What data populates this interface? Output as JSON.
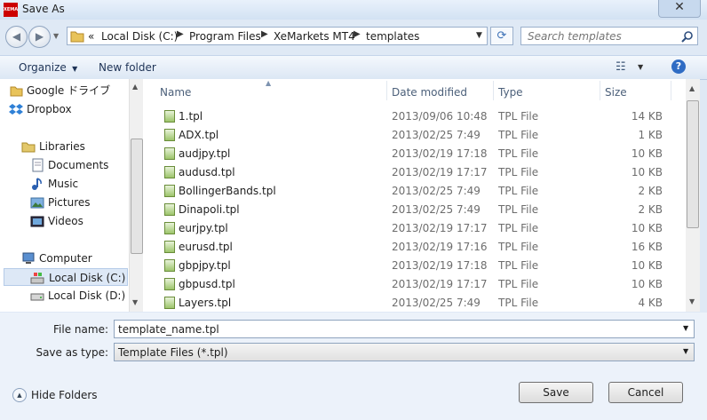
{
  "window": {
    "title": "Save As",
    "app_icon_text": "XEMA",
    "close_glyph": "✕"
  },
  "address": {
    "overflow_glyph": "«",
    "crumbs": [
      "Local Disk (C:)",
      "Program Files",
      "XeMarkets MT4",
      "templates"
    ]
  },
  "search": {
    "placeholder": "Search templates"
  },
  "toolbar": {
    "organize": "Organize",
    "new_folder": "New folder"
  },
  "nav": {
    "items": [
      "Google ドライブ",
      "Dropbox",
      "Libraries",
      "Documents",
      "Music",
      "Pictures",
      "Videos",
      "Computer",
      "Local Disk (C:)",
      "Local Disk (D:)"
    ]
  },
  "columns": {
    "name": "Name",
    "date": "Date modified",
    "type": "Type",
    "size": "Size"
  },
  "files": [
    {
      "name": "1.tpl",
      "date": "2013/09/06 10:48",
      "type": "TPL File",
      "size": "14 KB"
    },
    {
      "name": "ADX.tpl",
      "date": "2013/02/25 7:49",
      "type": "TPL File",
      "size": "1 KB"
    },
    {
      "name": "audjpy.tpl",
      "date": "2013/02/19 17:18",
      "type": "TPL File",
      "size": "10 KB"
    },
    {
      "name": "audusd.tpl",
      "date": "2013/02/19 17:17",
      "type": "TPL File",
      "size": "10 KB"
    },
    {
      "name": "BollingerBands.tpl",
      "date": "2013/02/25 7:49",
      "type": "TPL File",
      "size": "2 KB"
    },
    {
      "name": "Dinapoli.tpl",
      "date": "2013/02/25 7:49",
      "type": "TPL File",
      "size": "2 KB"
    },
    {
      "name": "eurjpy.tpl",
      "date": "2013/02/19 17:17",
      "type": "TPL File",
      "size": "10 KB"
    },
    {
      "name": "eurusd.tpl",
      "date": "2013/02/19 17:16",
      "type": "TPL File",
      "size": "16 KB"
    },
    {
      "name": "gbpjpy.tpl",
      "date": "2013/02/19 17:18",
      "type": "TPL File",
      "size": "10 KB"
    },
    {
      "name": "gbpusd.tpl",
      "date": "2013/02/19 17:17",
      "type": "TPL File",
      "size": "10 KB"
    },
    {
      "name": "Layers.tpl",
      "date": "2013/02/25 7:49",
      "type": "TPL File",
      "size": "4 KB"
    }
  ],
  "form": {
    "file_name_label": "File name:",
    "file_name_value": "template_name.tpl",
    "save_type_label": "Save as type:",
    "save_type_value": "Template Files (*.tpl)"
  },
  "buttons": {
    "hide_folders": "Hide Folders",
    "save": "Save",
    "cancel": "Cancel"
  }
}
